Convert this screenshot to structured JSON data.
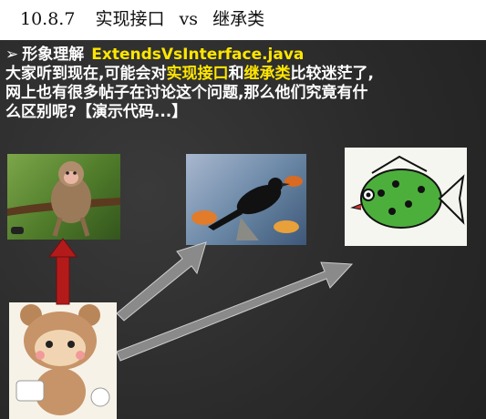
{
  "section_heading": {
    "number": "10.8.7",
    "title_left": "实现接口",
    "vs": "vs",
    "title_right": "继承类"
  },
  "slide": {
    "bullet_marker": "➢",
    "topic": "形象理解",
    "file_name": "ExtendsVsInterface.java",
    "para_1": "大家听到现在,可能会对",
    "highlight_1": "实现接口",
    "para_2": "和",
    "highlight_2": "继承类",
    "para_3": "比较迷茫了,",
    "line_3": "网上也有很多帖子在讨论这个问题,那么他们究竟有什",
    "line_4": "么区别呢?【演示代码...】"
  },
  "colors": {
    "highlight": "#ffe600",
    "arrow_inherit": "#b31b1b",
    "arrow_implement": "#8a8a8a",
    "slide_bg": "#2b2b2b"
  },
  "images": [
    "monkey-picture",
    "bird-picture",
    "fish-picture",
    "cartoon-bear-picture"
  ]
}
